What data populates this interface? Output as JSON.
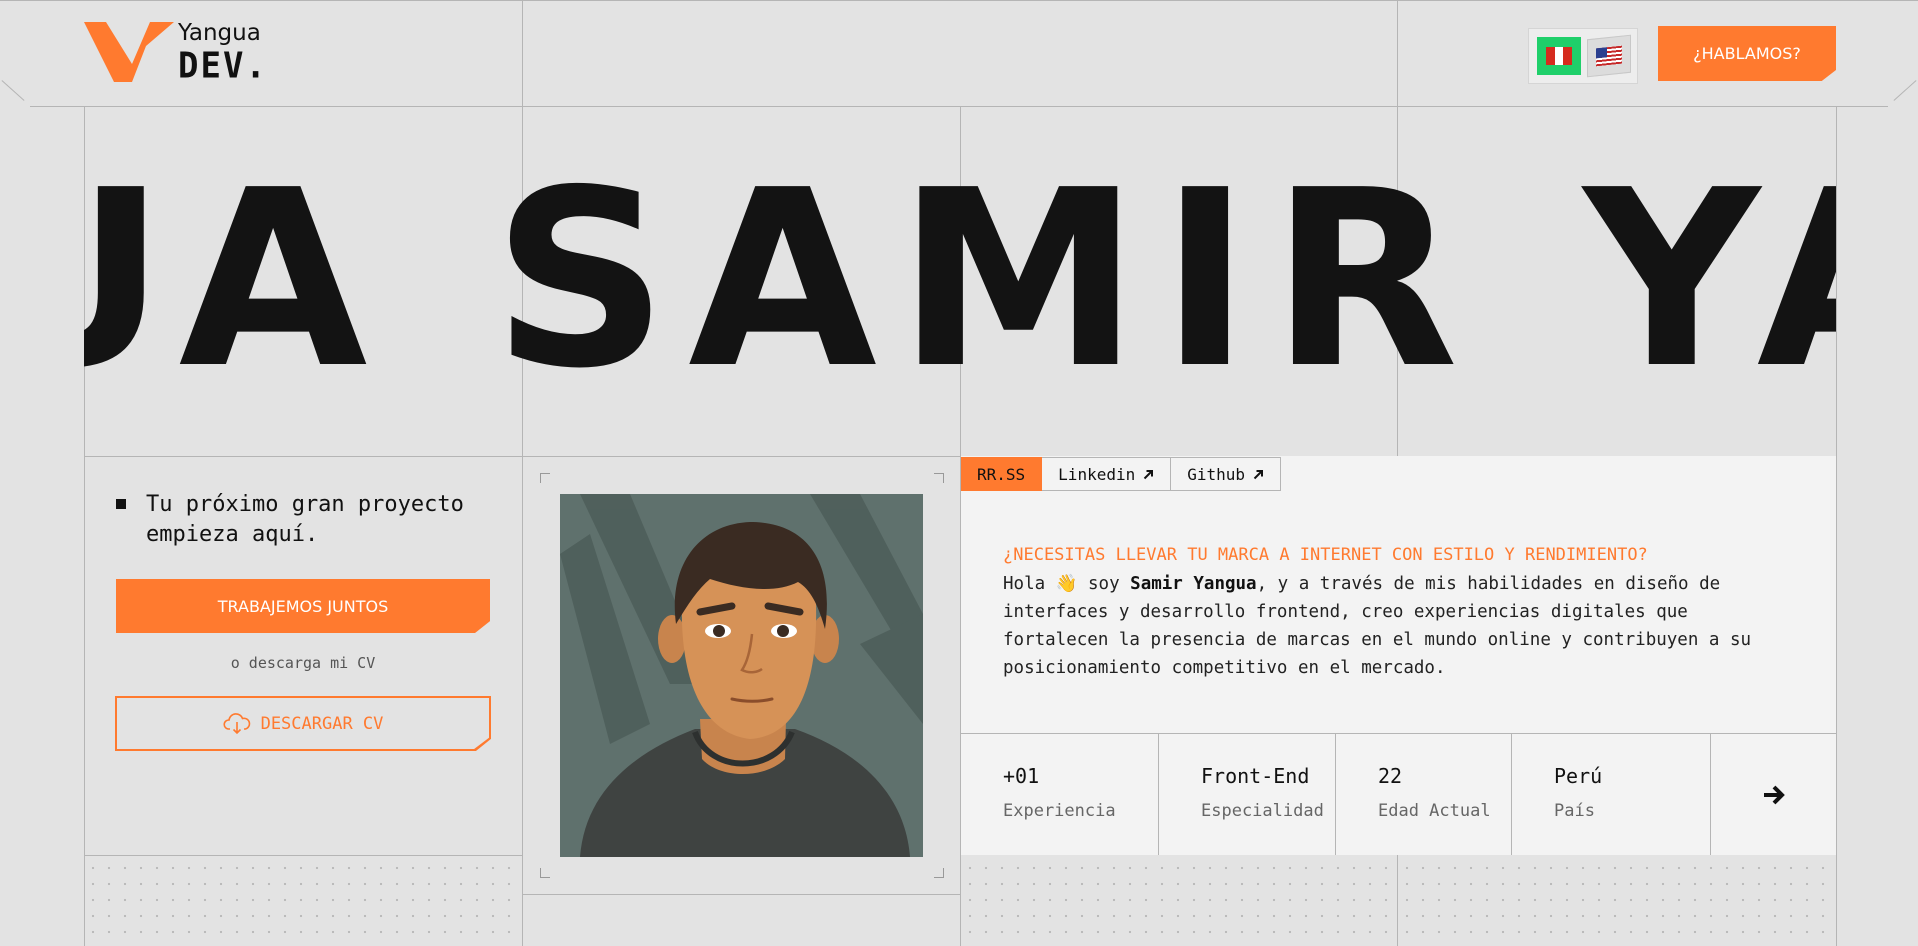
{
  "brand": {
    "name_top": "Yangua",
    "name_bottom": "DEV.",
    "accent": "#ff7a2f"
  },
  "header": {
    "cta_label": "¿HABLAMOS?"
  },
  "marquee": {
    "text": "UA SAMIR YA"
  },
  "intro": {
    "tagline": "Tu próximo gran proyecto empieza aquí.",
    "primary_button": "TRABAJEMOS JUNTOS",
    "or_text": "o descarga mi CV",
    "download_button": "DESCARGAR CV"
  },
  "tabs": [
    {
      "label": "RR.SS"
    },
    {
      "label": "Linkedin"
    },
    {
      "label": "Github"
    }
  ],
  "about": {
    "headline": "¿NECESITAS LLEVAR TU MARCA A INTERNET CON ESTILO Y RENDIMIENTO?",
    "greeting": "Hola 👋 soy ",
    "name": "Samir Yangua",
    "body": ", y a través de mis habilidades en diseño de interfaces y desarrollo frontend, creo experiencias digitales que fortalecen la presencia de marcas en el mundo online y contribuyen a su posicionamiento competitivo en el mercado."
  },
  "stats": [
    {
      "value": "+01",
      "label": "Experiencia"
    },
    {
      "value": "Front-End",
      "label": "Especialidad"
    },
    {
      "value": "22",
      "label": "Edad Actual"
    },
    {
      "value": "Perú",
      "label": "País"
    }
  ],
  "icons": {
    "next": "arrow-right-icon",
    "external": "arrow-up-right-icon",
    "download": "cloud-download-icon"
  }
}
